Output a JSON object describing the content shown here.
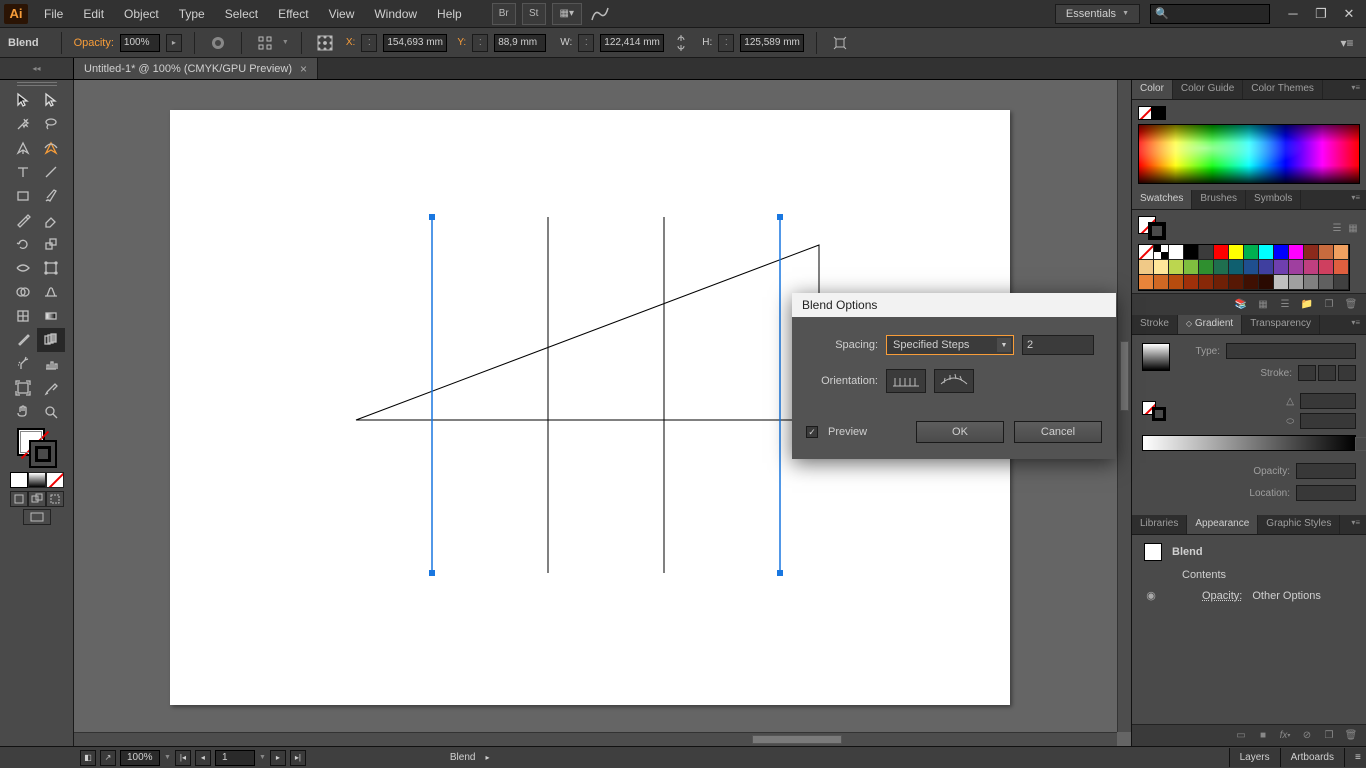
{
  "menu": {
    "items": [
      "File",
      "Edit",
      "Object",
      "Type",
      "Select",
      "Effect",
      "View",
      "Window",
      "Help"
    ]
  },
  "workspace": {
    "label": "Essentials"
  },
  "controlbar": {
    "tool_label": "Blend",
    "opacity_label": "Opacity:",
    "opacity_value": "100%",
    "x_label": "X:",
    "x_value": "154,693 mm",
    "y_label": "Y:",
    "y_value": "88,9 mm",
    "w_label": "W:",
    "w_value": "122,414 mm",
    "h_label": "H:",
    "h_value": "125,589 mm"
  },
  "tab": {
    "title": "Untitled-1* @ 100% (CMYK/GPU Preview)"
  },
  "dialog": {
    "title": "Blend Options",
    "spacing_label": "Spacing:",
    "spacing_mode": "Specified Steps",
    "spacing_value": "2",
    "orientation_label": "Orientation:",
    "preview_label": "Preview",
    "preview_checked": true,
    "ok": "OK",
    "cancel": "Cancel"
  },
  "panels": {
    "color_tabs": [
      "Color",
      "Color Guide",
      "Color Themes"
    ],
    "swatches_tabs": [
      "Swatches",
      "Brushes",
      "Symbols"
    ],
    "stroke_tabs": [
      "Stroke",
      "Gradient",
      "Transparency"
    ],
    "lib_tabs": [
      "Libraries",
      "Appearance",
      "Graphic Styles"
    ],
    "gradient": {
      "type_label": "Type:",
      "stroke_label": "Stroke:",
      "opacity_label": "Opacity:",
      "location_label": "Location:"
    },
    "appearance": {
      "object": "Blend",
      "contents": "Contents",
      "opacity_label": "Opacity:",
      "opacity_value": "Other Options"
    }
  },
  "swatch_colors": [
    [
      "diag",
      "reg",
      "#ffffff",
      "#000000",
      "#3b3b3b",
      "#ff0000",
      "#ffff00",
      "#00b050",
      "#00ffff",
      "#0000ff",
      "#ff00ff",
      "#8b2a1c",
      "#c86b3e",
      "#f0a060"
    ],
    [
      "#f0c987",
      "#ffe699",
      "#bcd64f",
      "#7fbf3f",
      "#2f8f2f",
      "#1f6f4f",
      "#0f5f6f",
      "#1f4f8f",
      "#3f3f9f",
      "#6f3faf",
      "#9f3f9f",
      "#bf3f7f",
      "#cf3f5f",
      "#df5f3f"
    ],
    [
      "#e8843a",
      "#d06824",
      "#b84c0e",
      "#a0300a",
      "#882808",
      "#6f2006",
      "#571804",
      "#3f1002",
      "#2a0a01",
      "#c0c0c0",
      "#a0a0a0",
      "#808080",
      "#606060",
      "#404040"
    ]
  ],
  "status": {
    "zoom": "100%",
    "artboard": "1",
    "tool": "Blend",
    "tabs": [
      "Layers",
      "Artboards"
    ]
  }
}
